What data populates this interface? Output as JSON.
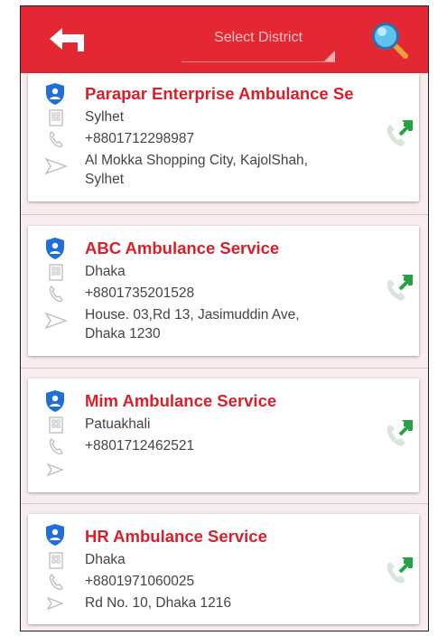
{
  "toolbar": {
    "district_placeholder": "Select District",
    "accent": "#e32833"
  },
  "cards": [
    {
      "name": "Parapar Enterprise Ambulance Se",
      "district": "Sylhet",
      "phone": "+8801712298987",
      "address_lines": [
        "Al Mokka Shopping City, KajolShah,",
        "Sylhet"
      ]
    },
    {
      "name": "ABC Ambulance Service",
      "district": "Dhaka",
      "phone": "+8801735201528",
      "address_lines": [
        "House. 03,Rd 13, Jasimuddin Ave,",
        "Dhaka 1230"
      ]
    },
    {
      "name": "Mim Ambulance Service",
      "district": "Patuakhali",
      "phone": "+8801712462521",
      "address_lines": []
    },
    {
      "name": "HR Ambulance  Service",
      "district": "Dhaka",
      "phone": "+8801971060025",
      "address_lines": [
        "Rd No. 10, Dhaka 1216"
      ]
    }
  ],
  "icons": {
    "back": "back-arrow-icon",
    "search": "magnifier-icon",
    "badge": "shield-icon",
    "district": "building-icon",
    "phone": "phone-icon",
    "address": "send-arrow-icon",
    "call": "call-icon"
  }
}
